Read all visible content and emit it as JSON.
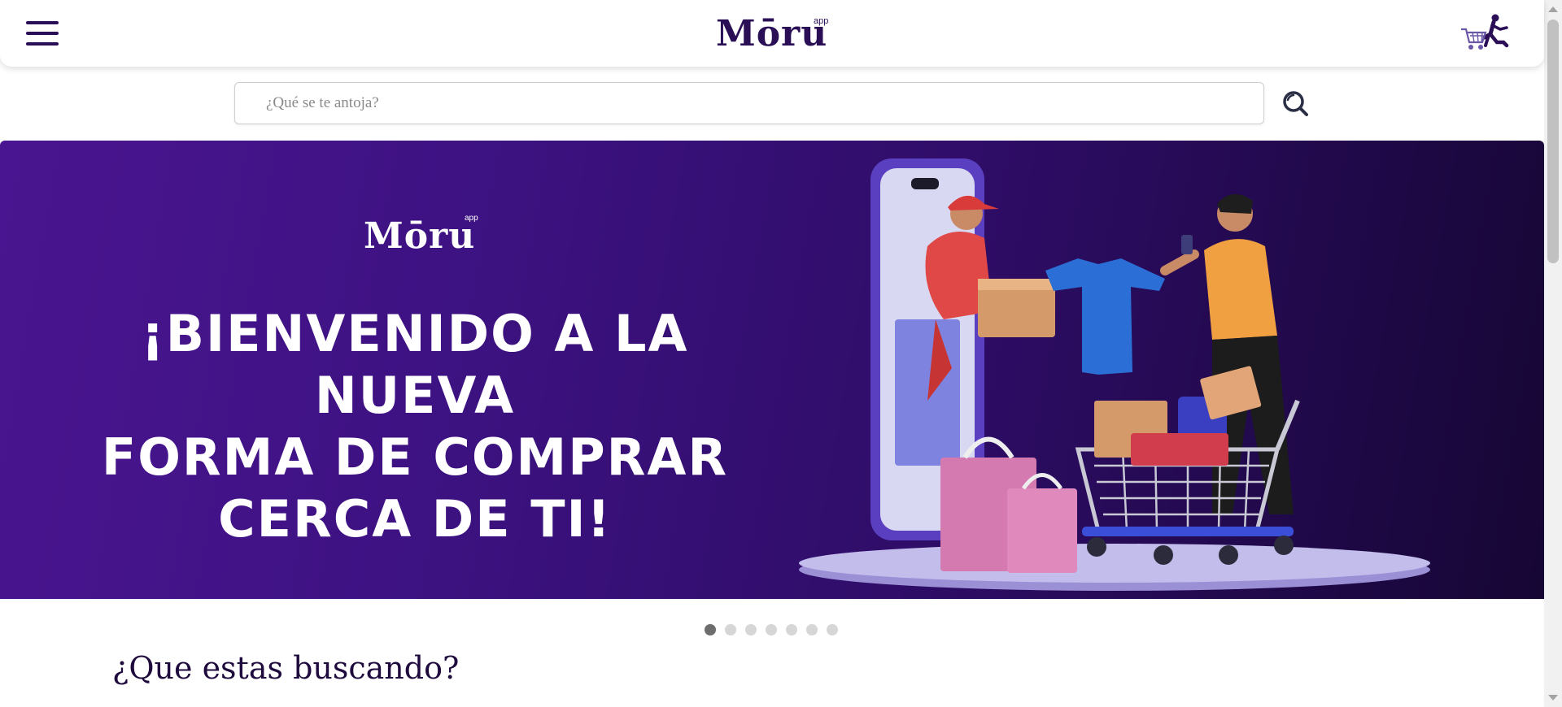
{
  "header": {
    "logo_text": "Mōru",
    "logo_sup": "app",
    "menu_icon": "hamburger-menu-icon",
    "cart_icon": "shopping-cart-runner-icon"
  },
  "search": {
    "placeholder": "¿Qué se te antoja?",
    "value": "",
    "icon": "search-icon"
  },
  "banner": {
    "logo_text": "Mōru",
    "logo_sup": "app",
    "headline_lines": [
      "¡BIENVENIDO A LA NUEVA",
      "FORMA DE COMPRAR",
      "CERCA DE TI!"
    ],
    "illustration": "delivery-phone-shopping-cart-illustration"
  },
  "carousel": {
    "dot_count": 7,
    "active_index": 0
  },
  "section": {
    "title": "¿Que estas buscando?"
  },
  "colors": {
    "brand": "#2a0f57",
    "banner_start": "#4a1590",
    "banner_end": "#160634"
  }
}
